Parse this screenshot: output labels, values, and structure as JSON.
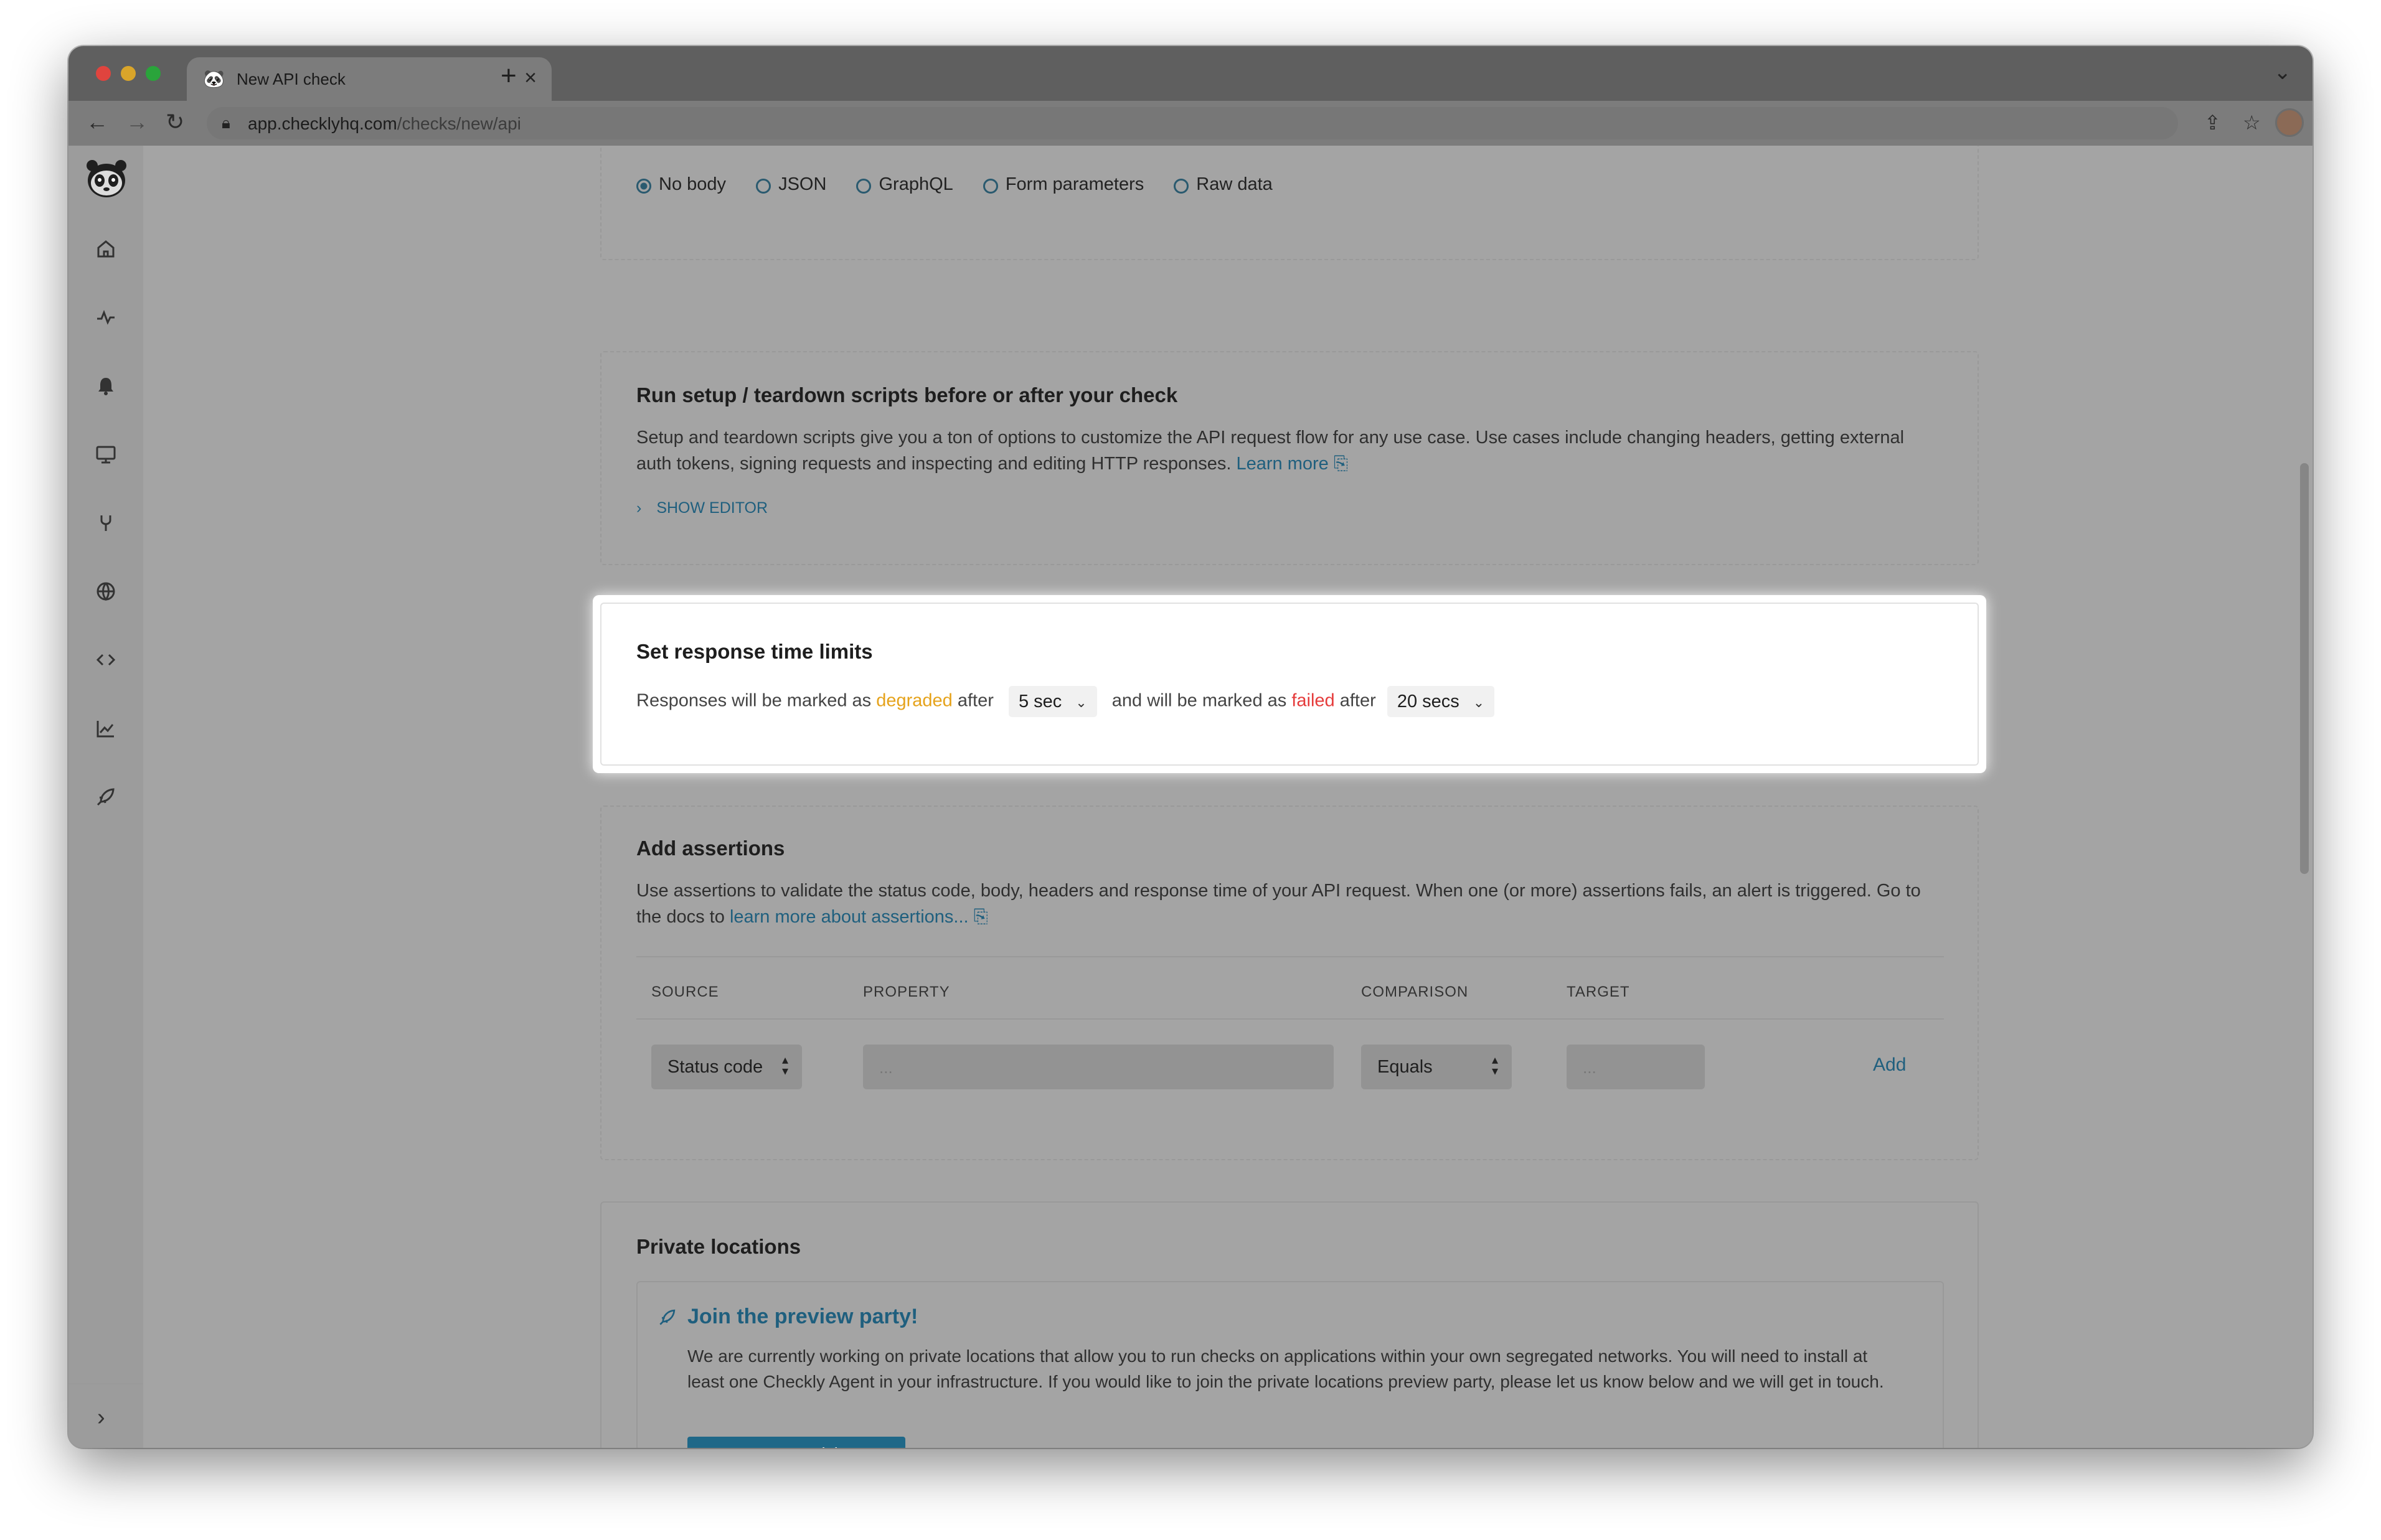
{
  "browser": {
    "tab_title": "New API check",
    "url_host": "app.checklyhq.com",
    "url_path": "/checks/new/api"
  },
  "sidebar": {
    "items": [
      {
        "icon": "home-icon"
      },
      {
        "icon": "activity-icon"
      },
      {
        "icon": "bell-icon"
      },
      {
        "icon": "monitor-icon"
      },
      {
        "icon": "wrench-icon"
      },
      {
        "icon": "globe-icon"
      },
      {
        "icon": "code-icon"
      },
      {
        "icon": "chart-icon"
      },
      {
        "icon": "rocket-icon"
      }
    ],
    "expand_icon": "chevron-right-icon"
  },
  "body_section": {
    "options": [
      "No body",
      "JSON",
      "GraphQL",
      "Form parameters",
      "Raw data"
    ],
    "selected": "No body"
  },
  "scripts_section": {
    "title": "Run setup / teardown scripts before or after your check",
    "description": "Setup and teardown scripts give you a ton of options to customize the API request flow for any use case. Use cases include changing headers, getting external auth tokens, signing requests and inspecting and editing HTTP responses.",
    "learn_more": "Learn more",
    "show_editor": "SHOW EDITOR"
  },
  "response_limits": {
    "title": "Set response time limits",
    "text_1": "Responses will be marked as",
    "degraded": "degraded",
    "after_1": "after",
    "degraded_value": "5 sec",
    "text_2": "and will be marked as",
    "failed": "failed",
    "after_2": "after",
    "failed_value": "20 secs"
  },
  "assertions": {
    "title": "Add assertions",
    "description": "Use assertions to validate the status code, body, headers and response time of your API request. When one (or more) assertions fails, an alert is triggered. Go to the docs to",
    "docs_link": "learn more about assertions...",
    "columns": [
      "SOURCE",
      "PROPERTY",
      "COMPARISON",
      "TARGET"
    ],
    "source_value": "Status code",
    "property_placeholder": "...",
    "comparison_value": "Equals",
    "target_placeholder": "...",
    "add_label": "Add"
  },
  "private_locations": {
    "title": "Private locations",
    "preview_title": "Join the preview party!",
    "preview_text": "We are currently working on private locations that allow you to run checks on applications within your own segregated networks. You will need to install at least one Checkly Agent in your infrastructure. If you would like to join the private locations preview party, please let us know below and we will get in touch.",
    "cta_label": "I want to participate"
  },
  "colors": {
    "degraded": "#e5a21a",
    "failed": "#e53b3b",
    "link": "#1f5f7e",
    "cta": "#1f6888"
  }
}
